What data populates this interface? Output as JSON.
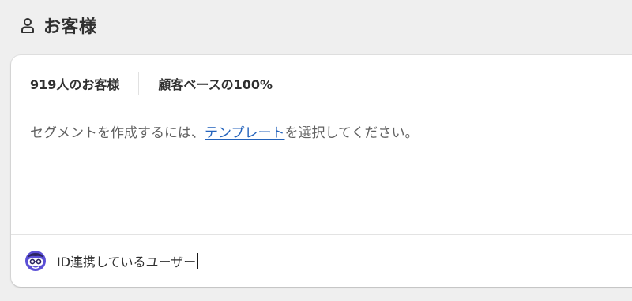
{
  "header": {
    "icon": "person-icon",
    "title": "お客様"
  },
  "stats": {
    "customer_count": "919人のお客様",
    "base_percent": "顧客ベースの100%"
  },
  "message": {
    "before": "セグメントを作成するには、",
    "link": "テンプレート",
    "after": "を選択してください。"
  },
  "query": {
    "avatar_icon": "avatar-icon",
    "value": "ID連携しているユーザー"
  },
  "colors": {
    "page_bg": "#efefef",
    "card_bg": "#ffffff",
    "link": "#2463bc",
    "avatar_purple": "#5b4fd6"
  }
}
